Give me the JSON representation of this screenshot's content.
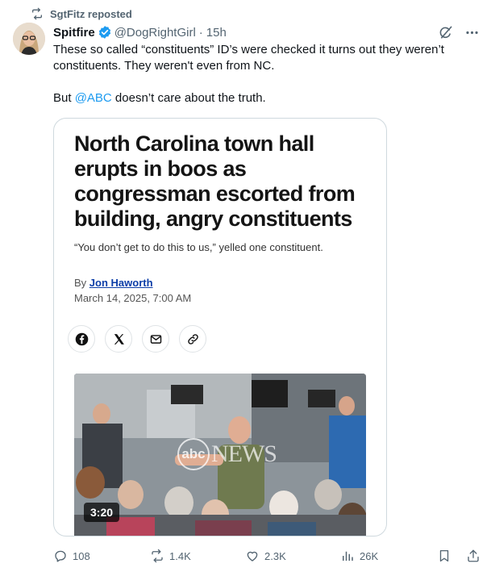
{
  "repost": {
    "label": "SgtFitz reposted",
    "icon": "repost-icon"
  },
  "author": {
    "display_name": "Spitfire",
    "handle": "@DogRightGirl",
    "separator": "·",
    "time": "15h",
    "verified": true,
    "badge_color": "#1d9bf0"
  },
  "tweet": {
    "line1": "These so called “constituents” ID’s were checked it turns out they weren’t constituents. They weren't even from NC.",
    "line2_pre": "But ",
    "line2_mention": "@ABC",
    "line2_post": " doesn’t care about the truth."
  },
  "card": {
    "headline": "North Carolina town hall erupts in boos as congressman escorted from building, angry constituents",
    "subhead": "“You don’t get to do this to us,” yelled one constituent.",
    "by_prefix": "By ",
    "author": "Jon Haworth",
    "date": "March 14, 2025, 7:00 AM",
    "share_icons": [
      "facebook-icon",
      "x-icon",
      "mail-icon",
      "link-icon"
    ],
    "video": {
      "duration": "3:20",
      "watermark_logo": "abc",
      "watermark_text": "NEWS"
    }
  },
  "actions": {
    "replies": "108",
    "reposts": "1.4K",
    "likes": "2.3K",
    "views": "26K"
  },
  "colors": {
    "accent": "#1d9bf0",
    "muted": "#536471",
    "border": "#cfd9de",
    "author_link": "#0c3ea8"
  }
}
